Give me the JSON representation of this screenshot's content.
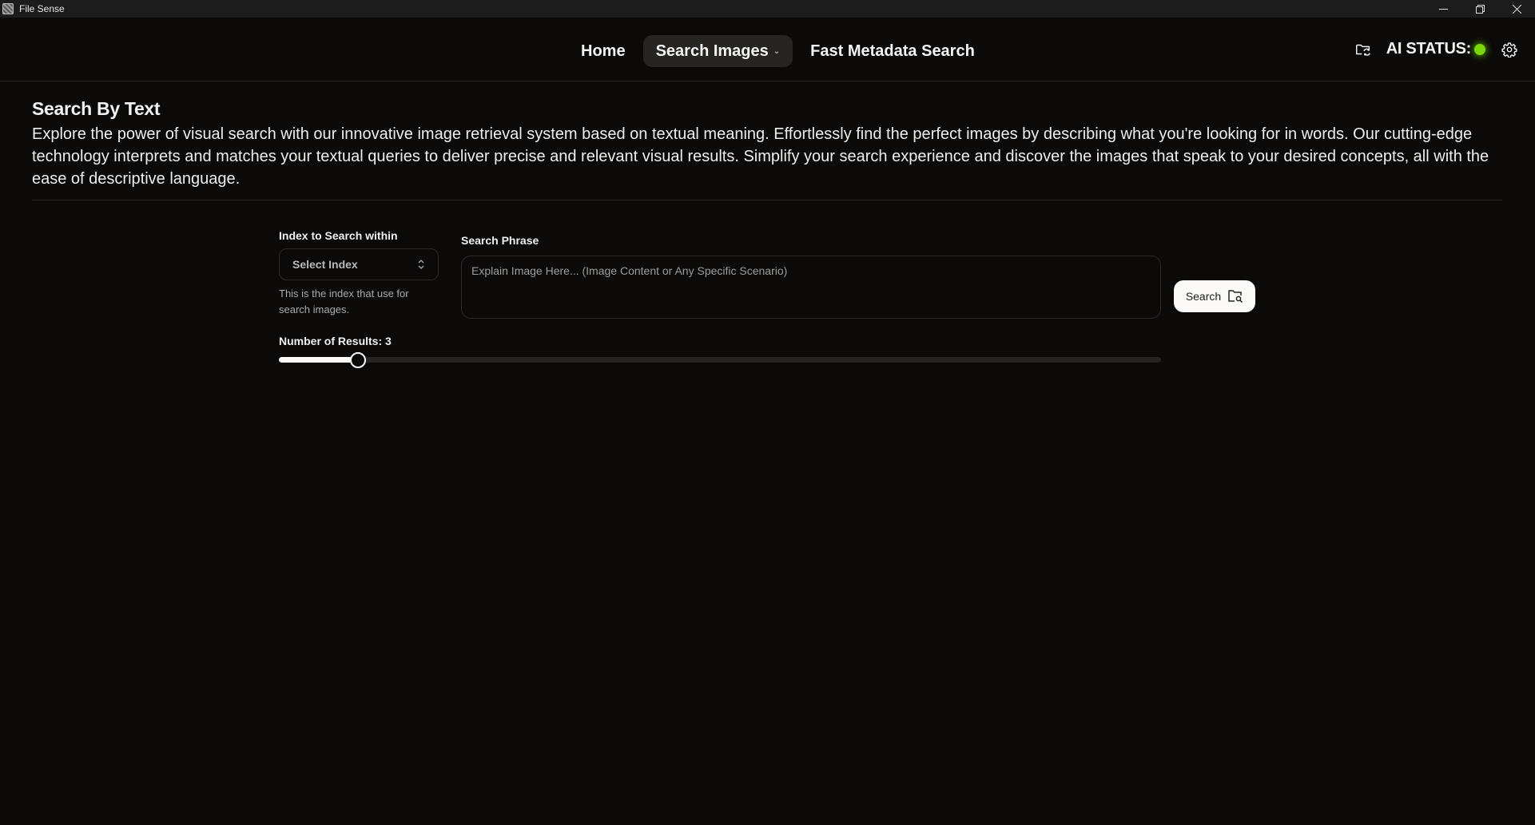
{
  "window": {
    "title": "File Sense",
    "controls": {
      "minimize": "minimize-icon",
      "maximize": "restore-icon",
      "close": "close-icon"
    }
  },
  "nav": {
    "items": [
      {
        "label": "Home",
        "active": false
      },
      {
        "label": "Search Images",
        "active": true,
        "has_dropdown": true,
        "chevron": "⌄"
      },
      {
        "label": "Fast Metadata Search",
        "active": false
      }
    ],
    "right": {
      "folder_icon": "folder-sync-icon",
      "ai_status_label": "AI STATUS:",
      "ai_status_state": "online",
      "ai_status_color": "#7ad60a",
      "settings_icon": "gear-icon"
    }
  },
  "hero": {
    "title": "Search By Text",
    "description": "Explore the power of visual search with our innovative image retrieval system based on textual meaning. Effortlessly find the perfect images by describing what you're looking for in words. Our cutting-edge technology interprets and matches your textual queries to deliver precise and relevant visual results. Simplify your search experience and discover the images that speak to your desired concepts, all with the ease of descriptive language."
  },
  "form": {
    "index": {
      "label": "Index to Search within",
      "selected": "Select Index",
      "helper": "This is the index that use for search images."
    },
    "phrase": {
      "label": "Search Phrase",
      "value": "",
      "placeholder": "Explain Image Here... (Image Content or Any Specific Scenario)"
    },
    "search_button": {
      "label": "Search",
      "icon": "folder-search-icon"
    },
    "results": {
      "label": "Number of Results: 3",
      "value": 3,
      "fill_fraction": 0.09
    }
  },
  "colors": {
    "background": "#0b0a09",
    "surface": "#262423",
    "accent": "#fbfaf8",
    "status_green": "#7ad60a"
  }
}
